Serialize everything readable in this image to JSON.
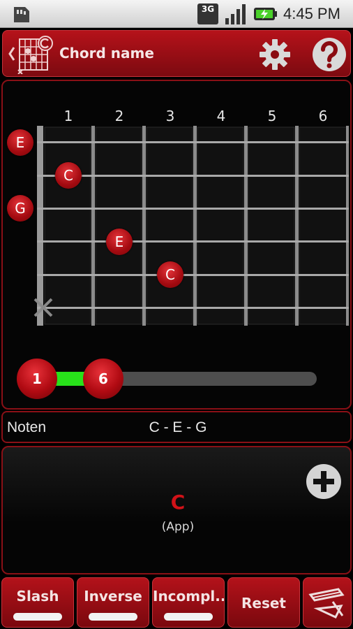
{
  "status": {
    "network": "3G",
    "time": "4:45 PM"
  },
  "header": {
    "title": "Chord name"
  },
  "fretboard": {
    "fret_numbers": [
      "1",
      "2",
      "3",
      "4",
      "5",
      "6"
    ],
    "open_notes": [
      {
        "string": 1,
        "note": "E"
      },
      {
        "string": 3,
        "note": "G"
      }
    ],
    "fretted_notes": [
      {
        "string": 2,
        "fret": 1,
        "note": "C"
      },
      {
        "string": 4,
        "fret": 2,
        "note": "E"
      },
      {
        "string": 5,
        "fret": 3,
        "note": "C"
      }
    ],
    "muted_strings": [
      6
    ]
  },
  "range": {
    "start": "1",
    "end": "6"
  },
  "notes_row": {
    "label": "Noten",
    "value": "C - E - G"
  },
  "result": {
    "chord": "C",
    "source": "(App)"
  },
  "buttons": {
    "slash": "Slash",
    "inverse": "Inverse",
    "incomplete": "Incompl...",
    "reset": "Reset"
  },
  "colors": {
    "accent": "#b3121a",
    "slider_fill": "#28e21a",
    "chord_text": "#d11218"
  }
}
